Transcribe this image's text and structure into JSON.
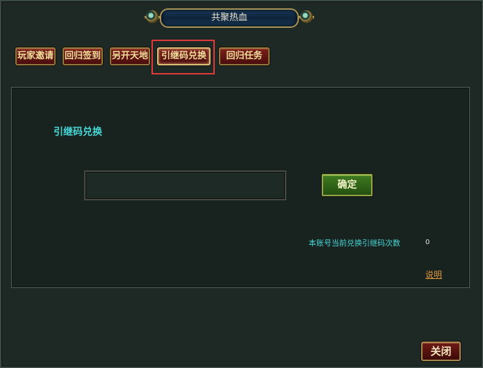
{
  "window": {
    "title": "共聚热血"
  },
  "tabs": [
    {
      "label": "玩家邀请",
      "active": false
    },
    {
      "label": "回归签到",
      "active": false
    },
    {
      "label": "另开天地",
      "active": false
    },
    {
      "label": "引继码兑换",
      "active": true
    },
    {
      "label": "回归任务",
      "active": false
    }
  ],
  "main": {
    "section_title": "引继码兑换",
    "code_input": {
      "value": "",
      "placeholder": ""
    },
    "confirm_label": "确定",
    "count_label": "本账号当前兑换引继码次数",
    "count_value": "0",
    "help_label": "说明"
  },
  "footer": {
    "close_label": "关闭"
  },
  "colors": {
    "panel_bg": "#1e2925",
    "accent_text": "#46d6d6",
    "tab_bg": "#6a1a16",
    "confirm_bg": "#3f7a20",
    "highlight": "#e23a3a",
    "link": "#e09a3a"
  }
}
